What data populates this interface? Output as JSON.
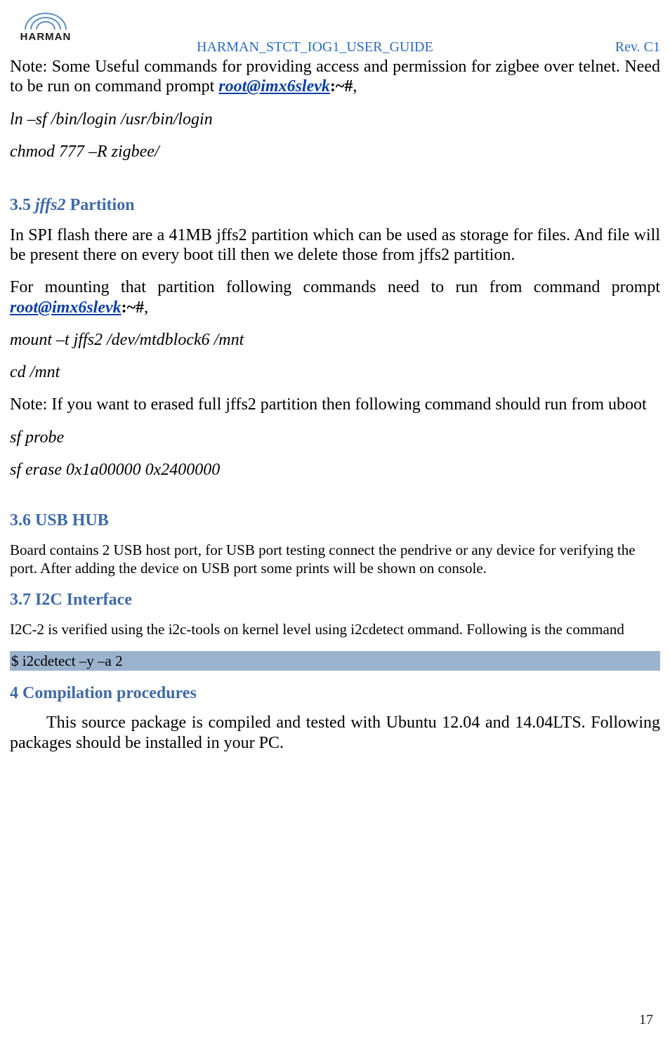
{
  "logo": {
    "brand": "HARMAN"
  },
  "header": {
    "doc_title": "HARMAN_STCT_IOG1_USER_GUIDE",
    "revision": "Rev. C1"
  },
  "content": {
    "note_zigbee_pre": "Note: Some Useful commands for providing access and permission for zigbee over telnet. Need to be run on command prompt  ",
    "prompt_email": "root@imx6slevk",
    "prompt_suffix": ":~#",
    "cmd1": "ln –sf /bin/login /usr/bin/login",
    "cmd2": "chmod 777 –R zigbee/",
    "sec35_num": "3.5 ",
    "sec35_jffs2": "jffs2",
    "sec35_rest": " Partition",
    "sec35_p1": "In SPI flash there are a 41MB jffs2 partition which can be used as storage for files. And file will be present there on every boot till then we delete those from jffs2 partition.",
    "sec35_p2_pre": "For mounting that partition following commands need to run from command prompt  ",
    "sec35_cmd1": "mount –t jffs2 /dev/mtdblock6 /mnt",
    "sec35_cmd2": "cd /mnt",
    "sec35_note": "Note: If you want to erased full jffs2 partition then following command should run from uboot",
    "sec35_cmd3": "sf probe",
    "sec35_cmd4": "sf erase 0x1a00000 0x2400000",
    "sec36_head": "3.6 USB HUB",
    "sec36_p1": "Board contains 2 USB host port, for USB port testing connect the pendrive or any device for verifying the port. After adding the device on USB port some prints will be shown on console.",
    "sec37_head": "3.7 I2C Interface",
    "sec37_p1": "I2C-2 is verified using the i2c-tools on kernel level using i2cdetect ommand. Following is the command",
    "sec37_cmd": "$ i2cdetect –y –a 2",
    "sec4_head": "4 Compilation procedures",
    "sec4_p1": "This source package is compiled and tested with Ubuntu 12.04 and 14.04LTS. Following packages should be installed in your PC.",
    "page_number": "17"
  }
}
